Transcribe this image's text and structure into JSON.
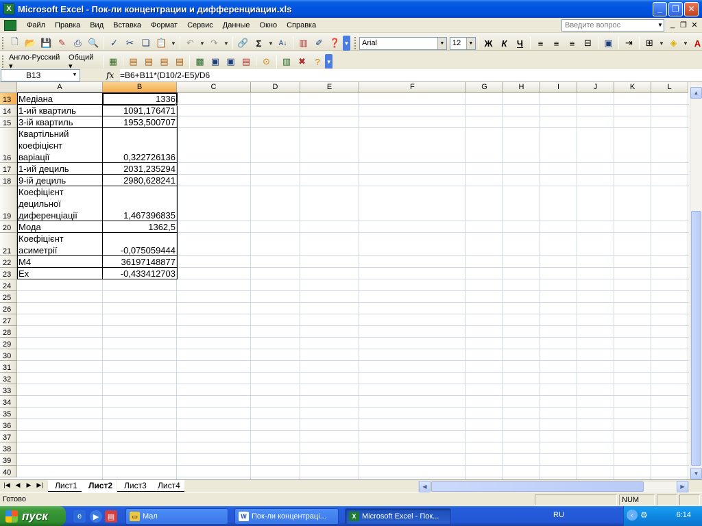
{
  "window": {
    "title": "Microsoft Excel - Пок-ли концентрации и дифференциации.xls",
    "app_icon_label": "X",
    "minimize": "_",
    "maximize": "❐",
    "close": "✕"
  },
  "menu": {
    "items": [
      "Файл",
      "Правка",
      "Вид",
      "Вставка",
      "Формат",
      "Сервис",
      "Данные",
      "Окно",
      "Справка"
    ],
    "help_placeholder": "Введите вопрос",
    "mdi_minimize": "_",
    "mdi_restore": "❐",
    "mdi_close": "✕"
  },
  "toolbar": {
    "font_name": "Arial",
    "font_size": "12",
    "bold": "Ж",
    "italic": "К",
    "underline": "Ч",
    "sum": "Σ",
    "language": "Англо-Русский",
    "general": "Общий"
  },
  "formula_bar": {
    "name_box": "B13",
    "fx": "fx",
    "formula": "=B6+B11*(D10/2-E5)/D6"
  },
  "columns": [
    "A",
    "B",
    "C",
    "D",
    "E",
    "F",
    "G",
    "H",
    "I",
    "J",
    "K",
    "L"
  ],
  "rows": [
    {
      "num": "13",
      "a": "Медіана",
      "b": "1336"
    },
    {
      "num": "14",
      "a": "1-ий квартиль",
      "b": "1091,176471"
    },
    {
      "num": "15",
      "a": "3-ій квартиль",
      "b": "1953,500707"
    },
    {
      "num": "16",
      "a": "Квартільний\nкоефіцієнт\nваріації",
      "b": "0,322726136"
    },
    {
      "num": "17",
      "a": "1-ий дециль",
      "b": "2031,235294"
    },
    {
      "num": "18",
      "a": "9-ій дециль",
      "b": "2980,628241"
    },
    {
      "num": "19",
      "a": "Коефіцієнт\nдецильної\nдиференціації",
      "b": "1,467396835"
    },
    {
      "num": "20",
      "a": "Мода",
      "b": "1362,5"
    },
    {
      "num": "21",
      "a": "Коефіцієнт\nасиметрії",
      "b": "-0,075059444"
    },
    {
      "num": "22",
      "a": "М4",
      "b": "36197148877"
    },
    {
      "num": "23",
      "a": "Ex",
      "b": "-0,433412703"
    },
    {
      "num": "24",
      "a": "",
      "b": ""
    },
    {
      "num": "25",
      "a": "",
      "b": ""
    },
    {
      "num": "26",
      "a": "",
      "b": ""
    },
    {
      "num": "27",
      "a": "",
      "b": ""
    },
    {
      "num": "28",
      "a": "",
      "b": ""
    },
    {
      "num": "29",
      "a": "",
      "b": ""
    },
    {
      "num": "30",
      "a": "",
      "b": ""
    },
    {
      "num": "31",
      "a": "",
      "b": ""
    },
    {
      "num": "32",
      "a": "",
      "b": ""
    },
    {
      "num": "33",
      "a": "",
      "b": ""
    },
    {
      "num": "34",
      "a": "",
      "b": ""
    },
    {
      "num": "35",
      "a": "",
      "b": ""
    },
    {
      "num": "36",
      "a": "",
      "b": ""
    },
    {
      "num": "37",
      "a": "",
      "b": ""
    },
    {
      "num": "38",
      "a": "",
      "b": ""
    },
    {
      "num": "39",
      "a": "",
      "b": ""
    },
    {
      "num": "40",
      "a": "",
      "b": ""
    }
  ],
  "sheets": {
    "tabs": [
      "Лист1",
      "Лист2",
      "Лист3",
      "Лист4"
    ],
    "active_index": 1
  },
  "status": {
    "ready": "Готово",
    "num": "NUM"
  },
  "taskbar": {
    "start": "пуск",
    "tasks": [
      "Мал",
      "Пок-ли концентраці...",
      "Microsoft Excel - Пок..."
    ],
    "lang": "RU",
    "clock": "6:14"
  },
  "colors": {
    "title_bar": "#0054e3",
    "selected_header": "#f3ac4d",
    "grid_line": "#d0d7e5",
    "taskbar": "#245edc",
    "start_button": "#3c9a3b"
  }
}
